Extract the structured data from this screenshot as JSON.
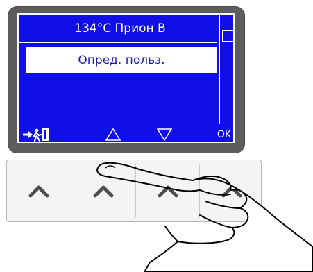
{
  "display": {
    "title": "134°C Прион В",
    "selected_option": "Опред. польз."
  },
  "softkeys": {
    "exit_icon": "exit-door-icon",
    "up_icon": "triangle-up-icon",
    "down_icon": "triangle-down-icon",
    "ok_label": "OK"
  },
  "hardware_buttons": [
    {
      "icon": "chevron-up-icon"
    },
    {
      "icon": "chevron-up-icon"
    },
    {
      "icon": "chevron-up-icon"
    },
    {
      "icon": "chevron-up-icon"
    }
  ],
  "colors": {
    "screen": "#1010e6",
    "bezel": "#5d5d5d",
    "text": "#ffffff"
  }
}
